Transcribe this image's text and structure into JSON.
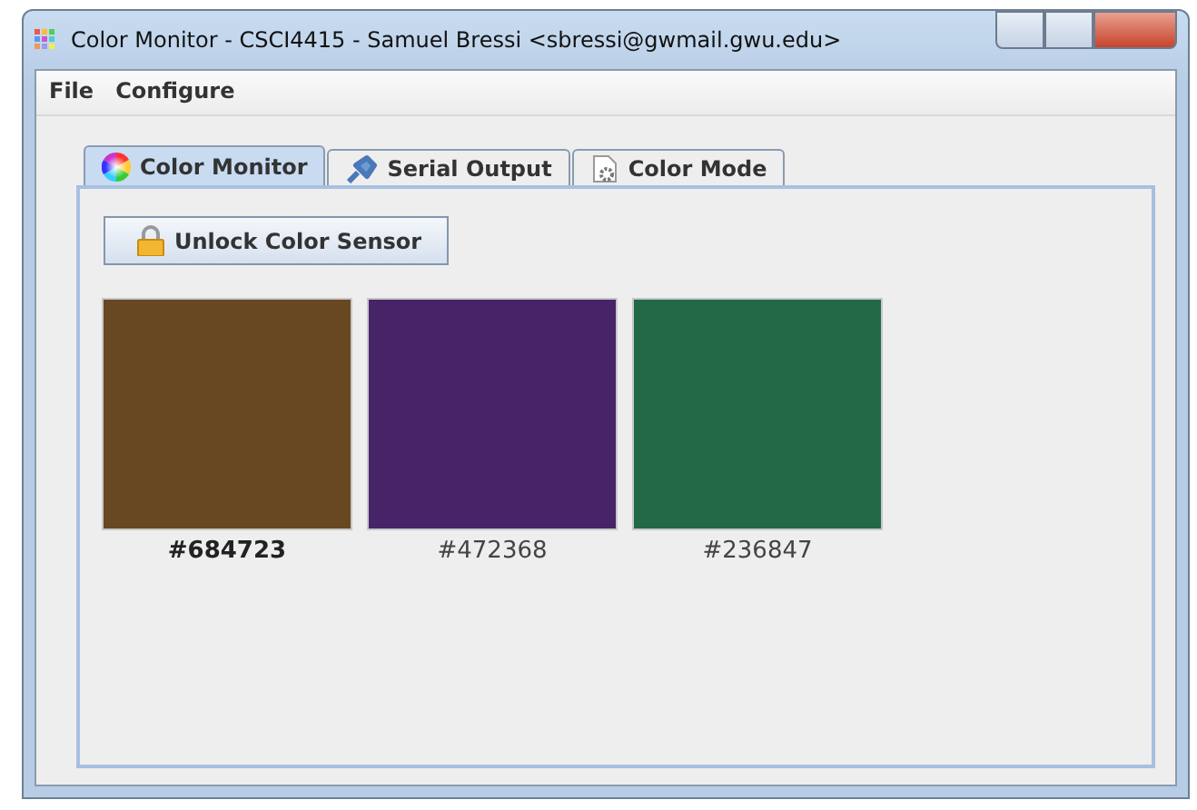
{
  "window": {
    "title": "Color Monitor - CSCI4415 - Samuel Bressi <sbressi@gwmail.gwu.edu>"
  },
  "menu": [
    "File",
    "Configure"
  ],
  "tabs": [
    {
      "label": "Color Monitor",
      "selected": true,
      "kind": "wheel"
    },
    {
      "label": "Serial Output",
      "selected": false,
      "kind": "plug"
    },
    {
      "label": "Color Mode",
      "selected": false,
      "kind": "gear"
    }
  ],
  "unlock_button": {
    "label": "Unlock Color Sensor"
  },
  "swatches": [
    {
      "label": "#684723",
      "color": "#684723",
      "selected": true
    },
    {
      "label": "#472368",
      "color": "#472368",
      "selected": false
    },
    {
      "label": "#236847",
      "color": "#236847",
      "selected": false
    }
  ]
}
